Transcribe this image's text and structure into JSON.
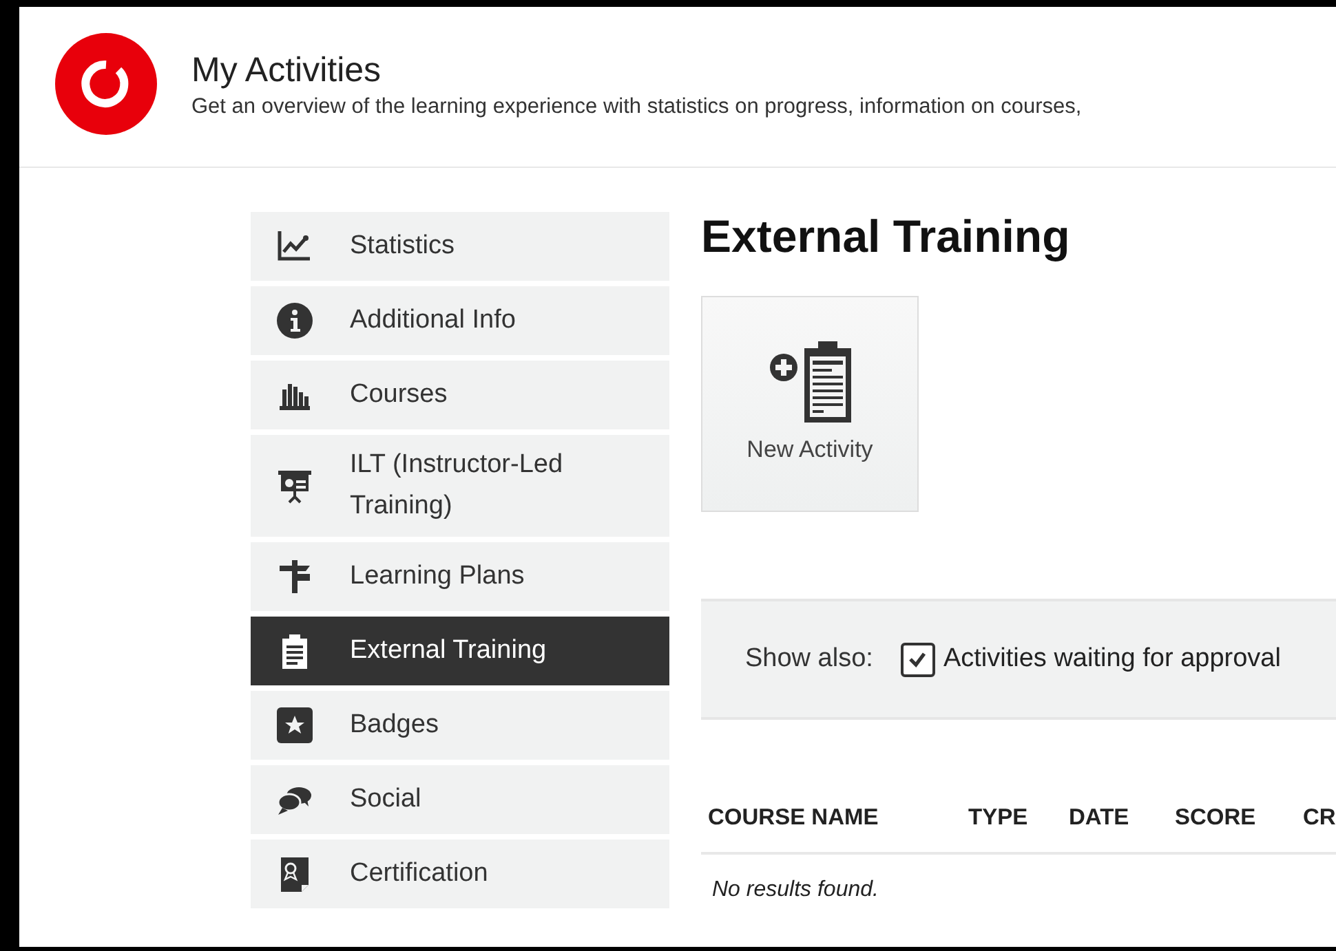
{
  "header": {
    "title": "My Activities",
    "subtitle": "Get an overview of the learning experience with statistics on progress, information on courses,"
  },
  "sidebar": {
    "items": [
      {
        "label": "Statistics",
        "kind": "chart",
        "selected": false
      },
      {
        "label": "Additional Info",
        "kind": "info",
        "selected": false
      },
      {
        "label": "Courses",
        "kind": "books",
        "selected": false
      },
      {
        "label": "ILT (Instructor-Led Training)",
        "kind": "presentation",
        "selected": false
      },
      {
        "label": "Learning Plans",
        "kind": "signpost",
        "selected": false
      },
      {
        "label": "External Training",
        "kind": "clipboard",
        "selected": true
      },
      {
        "label": "Badges",
        "kind": "star",
        "selected": false
      },
      {
        "label": "Social",
        "kind": "chat",
        "selected": false
      },
      {
        "label": "Certification",
        "kind": "certificate",
        "selected": false
      }
    ]
  },
  "main": {
    "title": "External Training",
    "actions": [
      {
        "label": "New Activity"
      }
    ],
    "filter": {
      "label": "Show also:",
      "options": [
        {
          "label": "Activities waiting for approval",
          "checked": true
        }
      ]
    },
    "table": {
      "columns": [
        "COURSE NAME",
        "TYPE",
        "DATE",
        "SCORE",
        "CR"
      ],
      "empty_message": "No results found."
    }
  }
}
